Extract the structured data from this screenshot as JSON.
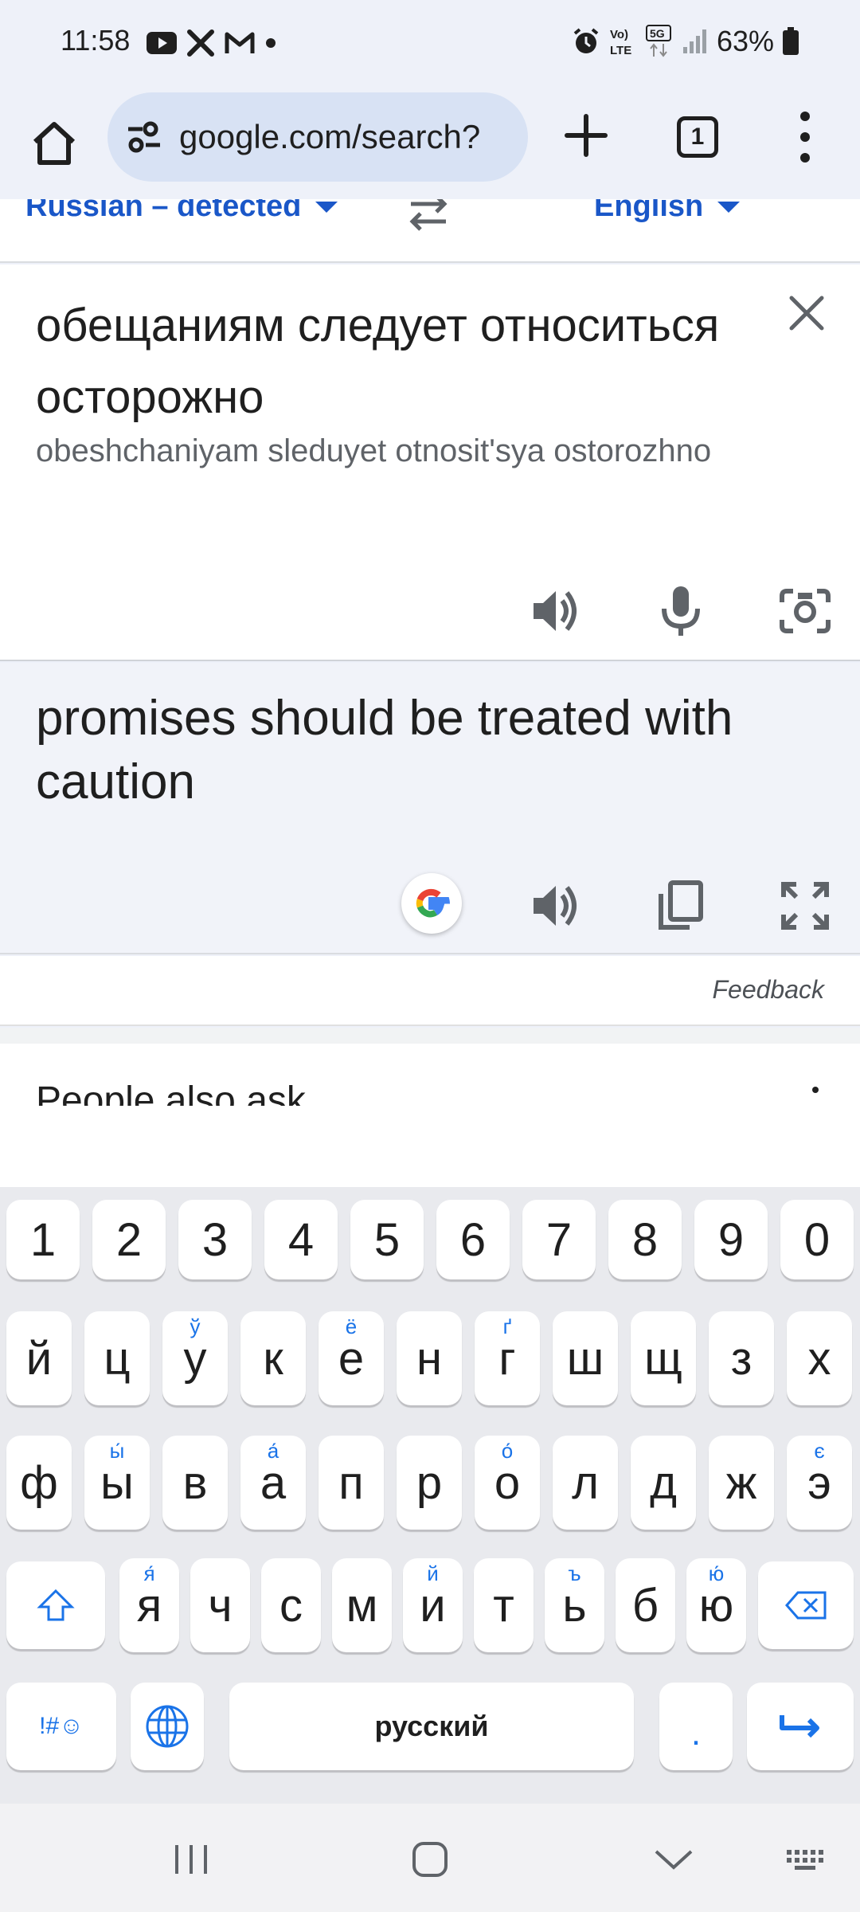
{
  "status_bar": {
    "time": "11:58",
    "battery": "63%",
    "notification_icons": [
      "youtube-icon",
      "tools-icon",
      "gmail-icon",
      "dot-icon"
    ],
    "system_icons": [
      "alarm-icon",
      "volte-icon",
      "5g-icon",
      "signal-icon",
      "battery-icon"
    ]
  },
  "browser": {
    "url": "google.com/search?",
    "tab_count": "1"
  },
  "translate": {
    "source_lang": "Russian – detected",
    "target_lang": "English",
    "source_text": "обещаниям следует относиться осторожно",
    "transliteration": "obeshchaniyam sleduyet otnosit'sya ostorozhno",
    "translation": "promises should be treated with caution",
    "feedback": "Feedback"
  },
  "people_also_ask": {
    "title": "People also ask"
  },
  "keyboard": {
    "number_row": [
      "1",
      "2",
      "3",
      "4",
      "5",
      "6",
      "7",
      "8",
      "9",
      "0"
    ],
    "row1": [
      {
        "k": "й",
        "s": ""
      },
      {
        "k": "ц",
        "s": ""
      },
      {
        "k": "у",
        "s": "ў"
      },
      {
        "k": "к",
        "s": ""
      },
      {
        "k": "е",
        "s": "ё"
      },
      {
        "k": "н",
        "s": ""
      },
      {
        "k": "г",
        "s": "ґ"
      },
      {
        "k": "ш",
        "s": ""
      },
      {
        "k": "щ",
        "s": ""
      },
      {
        "k": "з",
        "s": ""
      },
      {
        "k": "х",
        "s": ""
      }
    ],
    "row2": [
      {
        "k": "ф",
        "s": ""
      },
      {
        "k": "ы",
        "s": "ы́"
      },
      {
        "k": "в",
        "s": ""
      },
      {
        "k": "а",
        "s": "а́"
      },
      {
        "k": "п",
        "s": ""
      },
      {
        "k": "р",
        "s": ""
      },
      {
        "k": "о",
        "s": "о́"
      },
      {
        "k": "л",
        "s": ""
      },
      {
        "k": "д",
        "s": ""
      },
      {
        "k": "ж",
        "s": ""
      },
      {
        "k": "э",
        "s": "є"
      }
    ],
    "row3": [
      {
        "k": "я",
        "s": "я́"
      },
      {
        "k": "ч",
        "s": ""
      },
      {
        "k": "с",
        "s": ""
      },
      {
        "k": "м",
        "s": ""
      },
      {
        "k": "и",
        "s": "й"
      },
      {
        "k": "т",
        "s": ""
      },
      {
        "k": "ь",
        "s": "ъ"
      },
      {
        "k": "б",
        "s": ""
      },
      {
        "k": "ю",
        "s": "ю́"
      }
    ],
    "symbols_label": "!#☺",
    "space_label": "русский",
    "period_label": "."
  },
  "colors": {
    "accent_blue": "#1a57c8",
    "keyboard_bg": "#e9eaee",
    "url_bar": "#d8e2f4"
  }
}
